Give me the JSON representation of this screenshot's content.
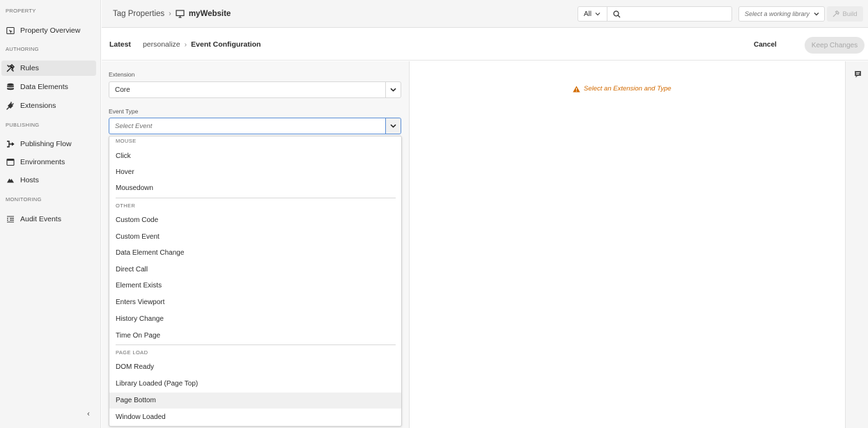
{
  "sidebar": {
    "sections": {
      "property": "PROPERTY",
      "authoring": "AUTHORING",
      "publishing": "PUBLISHING",
      "monitoring": "MONITORING"
    },
    "items": {
      "property_overview": "Property Overview",
      "rules": "Rules",
      "data_elements": "Data Elements",
      "extensions": "Extensions",
      "publishing_flow": "Publishing Flow",
      "environments": "Environments",
      "hosts": "Hosts",
      "audit_events": "Audit Events"
    },
    "active_item": "Rules",
    "collapse_glyph": "‹"
  },
  "topbar": {
    "breadcrumb_root": "Tag Properties",
    "breadcrumb_site": "myWebsite",
    "scope_value": "All",
    "search_value": "",
    "library_placeholder": "Select a working library",
    "build_label": "Build"
  },
  "subheader": {
    "latest_label": "Latest",
    "crumb_rule": "personalize",
    "crumb_current": "Event Configuration",
    "cancel_label": "Cancel",
    "keep_label": "Keep Changes"
  },
  "config": {
    "extension_label": "Extension",
    "extension_value": "Core",
    "event_type_label": "Event Type",
    "event_type_placeholder": "Select Event"
  },
  "event_menu": {
    "groups": {
      "mouse": "MOUSE",
      "other": "OTHER",
      "page_load": "PAGE LOAD"
    },
    "items": {
      "click": "Click",
      "hover": "Hover",
      "mousedown": "Mousedown",
      "custom_code": "Custom Code",
      "custom_event": "Custom Event",
      "data_element_change": "Data Element Change",
      "direct_call": "Direct Call",
      "element_exists": "Element Exists",
      "enters_viewport": "Enters Viewport",
      "history_change": "History Change",
      "time_on_page": "Time On Page",
      "dom_ready": "DOM Ready",
      "library_loaded": "Library Loaded (Page Top)",
      "page_bottom": "Page Bottom",
      "window_loaded": "Window Loaded"
    },
    "hovered_item": "Page Bottom"
  },
  "main": {
    "warning_text": "Select an Extension and Type"
  },
  "colors": {
    "warning": "#d26a00",
    "focus_border": "#5b8fd6"
  },
  "icons": {
    "property_overview": "property-overview-icon",
    "rules": "rules-icon",
    "data_elements": "database-icon",
    "extensions": "plug-icon",
    "publishing_flow": "publishing-flow-icon",
    "environments": "browser-window-icon",
    "hosts": "cloud-icon",
    "audit_events": "list-icon",
    "site": "monitor-icon",
    "search": "search-icon",
    "build": "hammer-icon",
    "warning": "alert-triangle-icon",
    "comment": "comment-icon"
  }
}
